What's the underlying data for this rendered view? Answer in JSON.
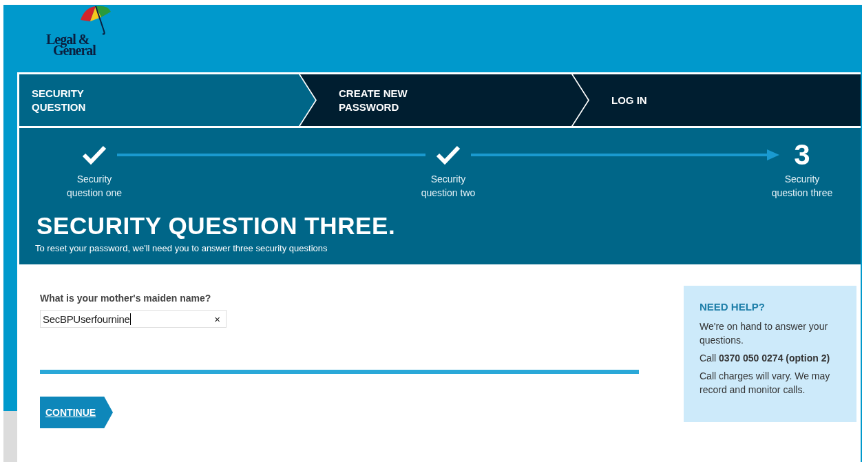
{
  "logo": {
    "line_1": "Legal &",
    "line_2": "General"
  },
  "tabs": [
    {
      "label": "SECURITY QUESTION",
      "selected": true
    },
    {
      "label": "CREATE NEW PASSWORD",
      "selected": false
    },
    {
      "label": "LOG IN",
      "selected": false
    }
  ],
  "steps": [
    {
      "label": "Security question one",
      "done": true
    },
    {
      "label": "Security question two",
      "done": true
    },
    {
      "label": "Security question three",
      "done": false,
      "number": "3"
    }
  ],
  "heading": "SECURITY QUESTION THREE.",
  "subtitle": "To reset your password, we'll need you to answer three security questions",
  "question": {
    "label": "What is your mother's maiden name?",
    "value": "SecBPUserfournine",
    "clear": "×"
  },
  "continue_button": "CONTINUE",
  "help": {
    "title": "NEED HELP?",
    "paragraphs": [
      "We're on hand to answer your questions.",
      "Call **0370 050 0274 (option 2)**",
      "Call charges will vary. We may record and monitor calls."
    ]
  }
}
